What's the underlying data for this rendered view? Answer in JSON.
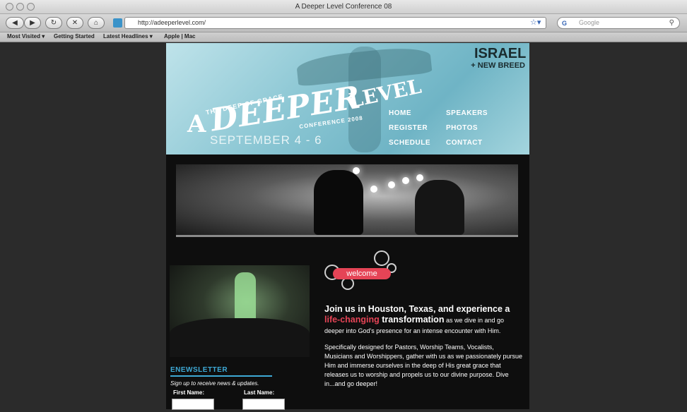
{
  "window": {
    "title": "A Deeper Level Conference 08"
  },
  "toolbar": {
    "url": "http://adeeperlevel.com/",
    "search_placeholder": "Google",
    "search_engine": "G"
  },
  "bookmarks": [
    "Most Visited ▾",
    "Getting Started",
    "Latest Headlines ▾",
    "Apple | Mac"
  ],
  "header": {
    "tagline": "THE DEEP OF GRACE",
    "logo_a": "A",
    "logo_deeper": "DEEPER",
    "logo_level": "LEVEL",
    "conference_year": "CONFERENCE 2008",
    "dates": "SEPTEMBER 4 - 6",
    "partner_top": "ISRAEL",
    "partner_bottom": "+ NEW BREED",
    "nav": [
      {
        "label": "HOME"
      },
      {
        "label": "REGISTER"
      },
      {
        "label": "SCHEDULE"
      },
      {
        "label": "SPEAKERS"
      },
      {
        "label": "PHOTOS"
      },
      {
        "label": "CONTACT"
      }
    ]
  },
  "welcome": {
    "label": "welcome"
  },
  "content": {
    "lead_pre": "Join us in Houston, Texas, and experience a ",
    "lead_highlight": "life-changing",
    "lead_bold_end": " transformation",
    "lead_rest": " as we dive in and go deeper into God's presence for an intense encounter with Him.",
    "body": "Specifically designed for Pastors, Worship Teams, Vocalists, Musicians and Worshippers, gather with us as we passionately pursue Him and immerse ourselves in the deep of His great grace that releases us to worship and propels us to our divine purpose. Dive in...and go deeper!"
  },
  "newsletter": {
    "title": "ENEWSLETTER",
    "subtitle": "Sign up to receive news & updates.",
    "first_name_label": "First Name:",
    "last_name_label": "Last Name:"
  },
  "colors": {
    "accent_red": "#e54456",
    "newsletter_blue": "#3ea9d6",
    "header_teal": "#8cc7d4"
  }
}
